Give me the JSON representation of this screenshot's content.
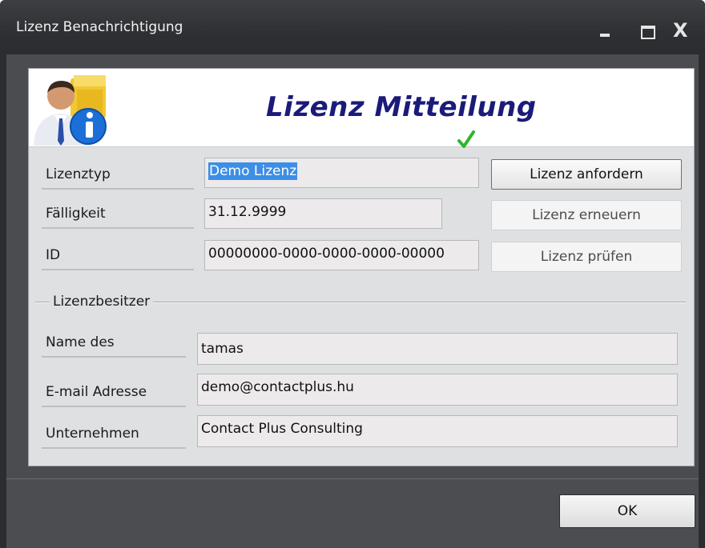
{
  "window": {
    "title": "Lizenz Benachrichtigung",
    "controls": {
      "minimize_icon": "minimize-icon",
      "maximize_icon": "maximize-icon",
      "close_label": "X"
    }
  },
  "banner": {
    "title": "Lizenz Mitteilung",
    "logo_icon": "user-info-icon"
  },
  "license": {
    "type_label": "Lizenztyp",
    "type_value": "Demo Lizenz",
    "due_label": "Fälligkeit",
    "due_value": "31.12.9999",
    "due_status_icon": "checkmark-icon",
    "id_label": "ID",
    "id_value": "00000000-0000-0000-0000-00000"
  },
  "actions": {
    "request": "Lizenz anfordern",
    "renew": "Lizenz erneuern",
    "check": "Lizenz prüfen"
  },
  "owner": {
    "group_label": "Lizenzbesitzer",
    "name_label": "Name des",
    "name_value": "tamas",
    "email_label": "E-mail Adresse",
    "email_value": "demo@contactplus.hu",
    "company_label": "Unternehmen",
    "company_value": "Contact Plus Consulting"
  },
  "footer": {
    "ok": "OK"
  },
  "colors": {
    "title_blue": "#1b1b7a",
    "selection": "#3d8ee6",
    "check_green": "#2db52d"
  }
}
